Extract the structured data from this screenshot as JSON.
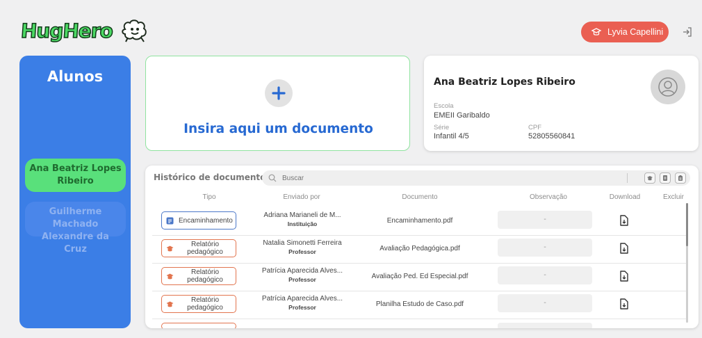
{
  "brand": {
    "logo_text": "HugHero",
    "logo_icon": "sheep-icon",
    "accent_green": "#4cd964",
    "primary_blue": "#3b7ee6",
    "danger_red": "#ea5f52"
  },
  "header": {
    "user_name": "Lyvia Capellini",
    "user_icon": "user-cap-icon",
    "logout_icon": "logout-icon"
  },
  "sidebar": {
    "title": "Alunos",
    "students": [
      {
        "name": "Ana Beatriz Lopes Ribeiro",
        "active": true
      },
      {
        "name": "Guilherme Machado Alexandre da Cruz",
        "active": false
      }
    ]
  },
  "upload": {
    "label": "Insira aqui um documento",
    "icon": "plus-icon"
  },
  "profile": {
    "name": "Ana Beatriz Lopes Ribeiro",
    "avatar_icon": "user-icon",
    "school_label": "Escola",
    "school": "EMEII Garibaldo",
    "grade_label": "Série",
    "grade": "Infantil 4/5",
    "cpf_label": "CPF",
    "cpf": "52805560841"
  },
  "history": {
    "title": "Histórico de documentos",
    "search_placeholder": "Buscar",
    "filter_icons": [
      "graduation-icon",
      "document-icon",
      "clipboard-icon"
    ],
    "columns": [
      "Tipo",
      "Enviado por",
      "Documento",
      "Observação",
      "Download",
      "Excluir"
    ],
    "rows": [
      {
        "type": "Encaminhamento",
        "type_kind": "encaminhamento",
        "sender": "Adriana Marianeli de M...",
        "role": "Instituição",
        "document": "Encaminhamento.pdf",
        "observation": "-"
      },
      {
        "type": "Relatório pedagógico",
        "type_kind": "relatorio",
        "sender": "Natalia Simonetti Ferreira",
        "role": "Professor",
        "document": "Avaliação Pedagógica.pdf",
        "observation": "-"
      },
      {
        "type": "Relatório pedagógico",
        "type_kind": "relatorio",
        "sender": "Patrícia Aparecida Alves...",
        "role": "Professor",
        "document": "Avaliação Ped. Ed Especial.pdf",
        "observation": "-"
      },
      {
        "type": "Relatório pedagógico",
        "type_kind": "relatorio",
        "sender": "Patrícia Aparecida Alves...",
        "role": "Professor",
        "document": "Planilha Estudo de Caso.pdf",
        "observation": "-"
      }
    ]
  }
}
